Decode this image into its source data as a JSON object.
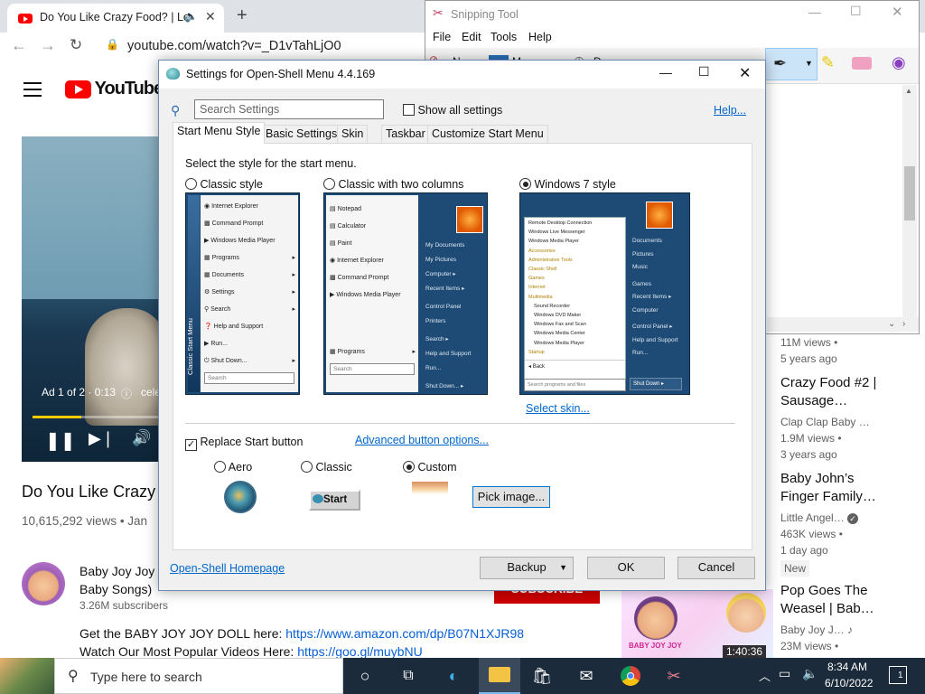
{
  "browser": {
    "tab_title": "Do You Like Crazy Food? | Le",
    "url": "youtube.com/watch?v=_D1vTahLjO0",
    "new_tab_symbol": "+"
  },
  "youtube": {
    "logo": "YouTube",
    "video_overlay": "Ad 1 of 2 · 0:13",
    "video_overlay_2": "cele",
    "video_title": "Do You Like Crazy",
    "views": "10,615,292 views • Jan",
    "channel_name": "Baby Joy Joy",
    "channel_sub": "Baby Songs)",
    "subscribers": "3.26M subscribers",
    "subscribe_label": "SUBSCRIBE",
    "desc_line1_prefix": "Get the BABY JOY JOY DOLL here: ",
    "desc_line1_link": "https://www.amazon.com/dp/B07N1XJR98",
    "desc_line2_prefix": "Watch Our Most Popular Videos Here: ",
    "desc_line2_link": "https://goo.gl/muybNU",
    "sidebar": [
      {
        "views": "11M views •",
        "age": "5 years ago"
      },
      {
        "title1": "Crazy Food #2 |",
        "title2": "Sausage…",
        "channel": "Clap Clap Baby …",
        "views": "1.9M views •",
        "age": "3 years ago"
      },
      {
        "title1": "Baby John’s",
        "title2": "Finger Family…",
        "channel": "Little Angel…",
        "views": "463K views •",
        "age": "1 day ago",
        "badge": "New"
      },
      {
        "title1": "Pop Goes The",
        "title2": "Weasel | Bab…",
        "channel": "Baby Joy J…",
        "views": "23M views •",
        "duration": "1:40:36",
        "thumb_text": "BABY JOY JOY"
      }
    ]
  },
  "snipping": {
    "title": "Snipping Tool",
    "menu": [
      "File",
      "Edit",
      "Tools",
      "Help"
    ],
    "toolbar_fragments": [
      "N",
      "M",
      "D"
    ]
  },
  "dialog": {
    "title": "Settings for Open-Shell Menu 4.4.169",
    "search_placeholder": "Search Settings",
    "show_all": "Show all settings",
    "help": "Help...",
    "tabs": [
      "Start Menu Style",
      "Basic Settings",
      "Skin",
      "Taskbar",
      "Customize Start Menu"
    ],
    "select_style": "Select the style for the start menu.",
    "styles": [
      {
        "label": "Classic style",
        "selected": false
      },
      {
        "label": "Classic with two columns",
        "selected": false
      },
      {
        "label": "Windows 7 style",
        "selected": true
      }
    ],
    "select_skin": "Select skin...",
    "replace_start": "Replace Start button",
    "replace_checked": true,
    "advanced_button": "Advanced button options...",
    "button_styles": [
      {
        "label": "Aero",
        "selected": false
      },
      {
        "label": "Classic",
        "selected": false
      },
      {
        "label": "Custom",
        "selected": true
      }
    ],
    "classic_btn_label": "Start",
    "pick_image": "Pick image...",
    "homepage": "Open-Shell Homepage",
    "backup": "Backup",
    "ok": "OK",
    "cancel": "Cancel",
    "preview_classic": {
      "items": [
        "Internet Explorer",
        "Command Prompt",
        "Windows Media Player",
        "Programs",
        "Documents",
        "Settings",
        "Search",
        "Help and Support",
        "Run...",
        "Shut Down..."
      ],
      "sidebar": "Classic Start Menu",
      "search": "Search"
    },
    "preview_two": {
      "left": [
        "Notepad",
        "Calculator",
        "Paint",
        "Internet Explorer",
        "Command Prompt",
        "Windows Media Player"
      ],
      "programs": "Programs",
      "right": [
        "My Documents",
        "My Pictures",
        "Computer",
        "Recent Items",
        "Control Panel",
        "Printers",
        "Search",
        "Help and Support",
        "Run..."
      ],
      "shutdown": "Shut Down...",
      "search": "Search"
    },
    "preview_win7": {
      "left": [
        "Remote Desktop Connection",
        "Windows Live Messenger",
        "Windows Media Player",
        "Accessories",
        "Administrative Tools",
        "Classic Shell",
        "Games",
        "Internet",
        "Multimedia",
        "Sound Recorder",
        "Windows DVD Maker",
        "Windows Fax and Scan",
        "Windows Media Center",
        "Windows Media Player",
        "Startup"
      ],
      "back": "Back",
      "right": [
        "Documents",
        "Pictures",
        "Music",
        "Games",
        "Recent Items",
        "Computer",
        "Control Panel",
        "Help and Support",
        "Run..."
      ],
      "search": "Search programs and files",
      "shutdown": "Shut Down"
    }
  },
  "taskbar": {
    "search_placeholder": "Type here to search",
    "time": "8:34 AM",
    "date": "6/10/2022",
    "notif_count": "1"
  }
}
